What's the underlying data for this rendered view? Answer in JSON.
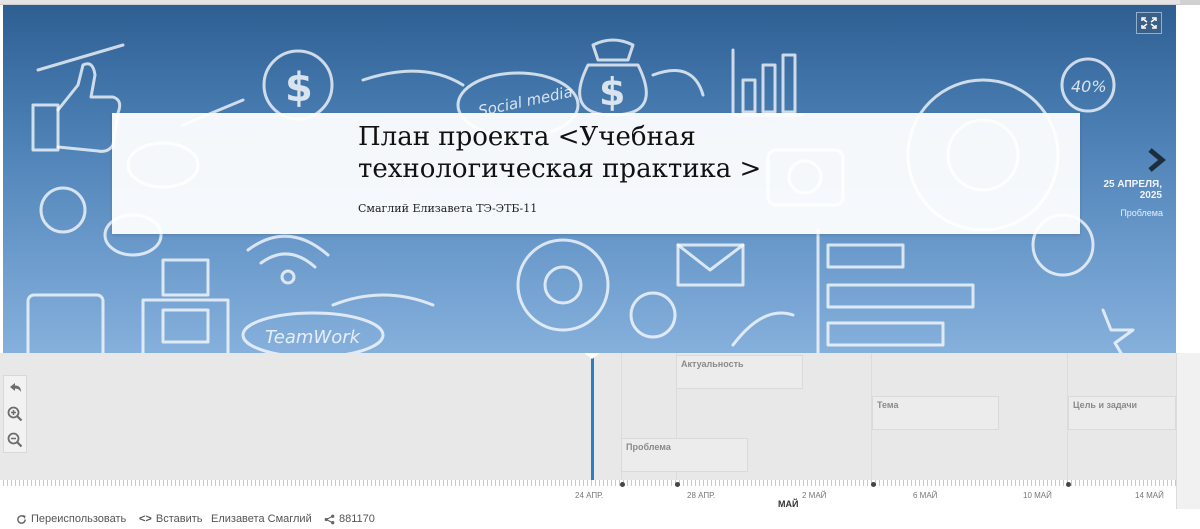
{
  "hero": {
    "title": "План проекта <Учебная технологическая практика >",
    "author": "Смаглий Елизавета ТЭ-ЭТБ-11",
    "date": "25 АПРЕЛЯ, 2025",
    "side_label": "Проблема",
    "background_text": {
      "social": "Social media",
      "teamwork": "TeamWork",
      "percent": "40%",
      "dollar": "$"
    }
  },
  "timeline": {
    "events": [
      {
        "label": "Актуальность"
      },
      {
        "label": "Тема"
      },
      {
        "label": "Цель и задачи"
      },
      {
        "label": "Проблема"
      }
    ],
    "axis": {
      "ticks": [
        "24 АПР.",
        "28 АПР.",
        "2 МАЙ",
        "6 МАЙ",
        "10 МАЙ",
        "14 МАЙ"
      ],
      "month": "МАЙ"
    }
  },
  "footer": {
    "reuse": "Переиспользовать",
    "embed": "Вставить",
    "user": "Елизавета Смаглий",
    "shares": "881170"
  },
  "icons": {
    "fullscreen": "fullscreen-icon",
    "next": "chevron-right-icon",
    "back": "back-arrow-icon",
    "zoom_in": "zoom-in-icon",
    "zoom_out": "zoom-out-icon",
    "reuse": "refresh-icon",
    "embed": "code-icon",
    "share": "share-icon"
  },
  "colors": {
    "hero_top": "#2e5f93",
    "hero_bottom": "#86b0dc",
    "now_line": "#2c7dc8",
    "timeline_bg": "#e8e8e8"
  }
}
